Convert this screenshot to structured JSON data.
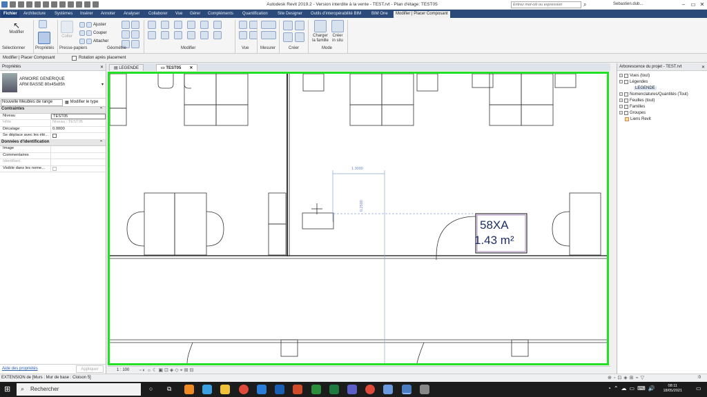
{
  "app": {
    "title": "Autodesk Revit 2019.2 - Version interdite à la vente - TEST.rvt - Plan d'étage: TEST05",
    "search_placeholder": "Entrez mot-clé ou expression",
    "user": "Sebastien.dub..."
  },
  "tabs": [
    "Fichier",
    "Architecture",
    "Systèmes",
    "Insérer",
    "Annoter",
    "Analyser",
    "Collaborer",
    "Vue",
    "Gérer",
    "Compléments",
    "Quantification",
    "Site Designer",
    "Outils d'interopérabilité BIM",
    "BIM One",
    "Modifier | Placer Composant"
  ],
  "ribbon": {
    "modify": "Modifier",
    "paste": "Coller",
    "cut": "Couper",
    "attach": "Attacher",
    "adjust": "Ajuster",
    "load_family": "Charger\nla famille",
    "create_in_place": "Créer\nin situ",
    "groups": [
      "Sélectionner",
      "Propriétés",
      "Presse-papiers",
      "Géométrie",
      "Modifier",
      "Vue",
      "Mesurer",
      "Créer",
      "Mode"
    ]
  },
  "optionbar": {
    "context": "Modifier | Placer Composant",
    "rotate_checkbox": "Rotation après placement"
  },
  "properties": {
    "title": "Propriétés",
    "family": "ARMOIRE GENERIQUE",
    "type": "ARM BASSE 80x45x85h",
    "instance_selector": "Nouvelle Meubles de range",
    "edit_type": "Modifier le type",
    "sections": [
      {
        "name": "Contraintes",
        "rows": [
          {
            "k": "Niveau",
            "v": "TEST05",
            "disabled": false
          },
          {
            "k": "Hôte",
            "v": "Niveau : TEST05",
            "disabled": true
          },
          {
            "k": "Décalage",
            "v": "0.0000",
            "disabled": false
          },
          {
            "k": "Se déplace avec les élé...",
            "v": "",
            "disabled": false
          }
        ]
      },
      {
        "name": "Données d'identification",
        "rows": [
          {
            "k": "Image",
            "v": "",
            "disabled": false
          },
          {
            "k": "Commentaires",
            "v": "",
            "disabled": false
          },
          {
            "k": "Identifiant",
            "v": "",
            "disabled": true
          },
          {
            "k": "Visible dans les nome...",
            "v": "",
            "disabled": false
          }
        ]
      }
    ],
    "help_link": "Aide des propriétés",
    "apply": "Appliquer"
  },
  "view_tabs": [
    "LEGENDE",
    "TEST05"
  ],
  "canvas": {
    "dim_h": "1.3000",
    "dim_v": "0.2500",
    "room_name": "58XA",
    "room_area": "1.43 m²"
  },
  "viewbar": {
    "scale": "1 : 100"
  },
  "browser": {
    "title": "Arborescence du projet - TEST.rvt",
    "items": [
      {
        "label": "Vues (tout)",
        "indent": 0
      },
      {
        "label": "Légendes",
        "indent": 0
      },
      {
        "label": "LEGENDE",
        "indent": 1
      },
      {
        "label": "Nomenclatures/Quantités (Tout)",
        "indent": 0
      },
      {
        "label": "Feuilles (tout)",
        "indent": 0
      },
      {
        "label": "Familles",
        "indent": 0
      },
      {
        "label": "Groupes",
        "indent": 0
      },
      {
        "label": "Liens Revit",
        "indent": 0
      }
    ]
  },
  "status": {
    "text": "EXTENSION de [Murs : Mur de base : Cloison 5]",
    "coord": ":0"
  },
  "taskbar": {
    "search": "Rechercher",
    "time": "08:11",
    "date": "18/05/2021"
  }
}
